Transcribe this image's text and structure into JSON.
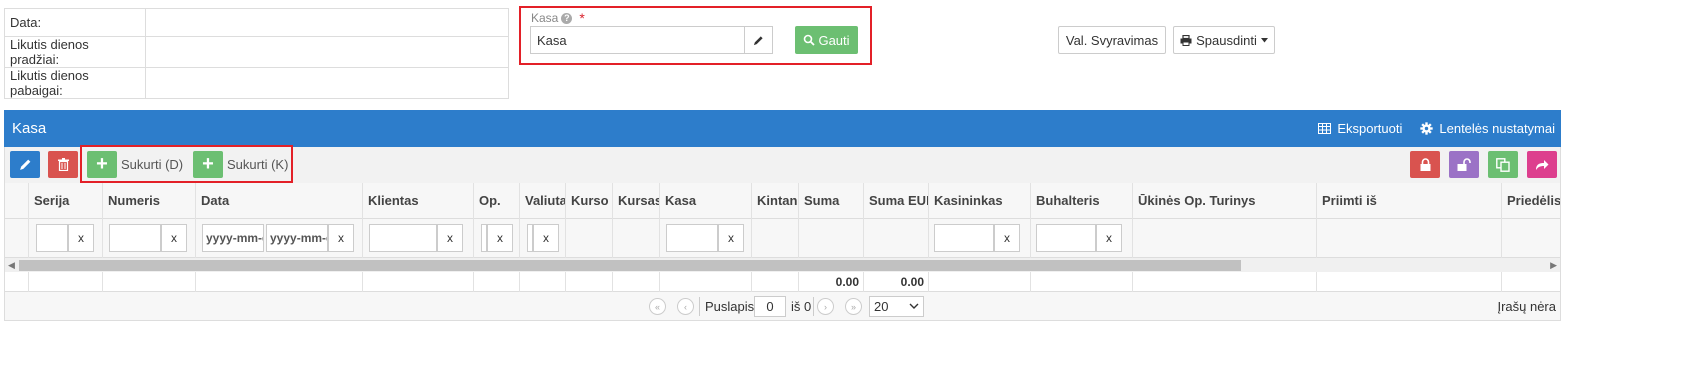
{
  "info": {
    "rows": [
      {
        "label": "Data:",
        "value": ""
      },
      {
        "label": "Likutis dienos pradžiai:",
        "value": ""
      },
      {
        "label": "Likutis dienos pabaigai:",
        "value": ""
      }
    ]
  },
  "kasa": {
    "label": "Kasa",
    "help": "?",
    "required": "*",
    "value": "Kasa",
    "get_button": "Gauti"
  },
  "actions": {
    "currency_button": "Val. Svyravimas",
    "print_button": "Spausdinti"
  },
  "panel": {
    "title": "Kasa",
    "export_label": "Eksportuoti",
    "settings_label": "Lentelės nustatymai"
  },
  "toolbar": {
    "create_debit": "Sukurti (D)",
    "create_credit": "Sukurti (K)",
    "plus": "+"
  },
  "table": {
    "columns": [
      "Serija",
      "Numeris",
      "Data",
      "Klientas",
      "Op.",
      "Valiuta",
      "Kurso d",
      "Kursas",
      "Kasa",
      "Kintan",
      "Suma",
      "Suma EUR",
      "Kasininkas",
      "Buhalteris",
      "Ūkinės Op. Turinys",
      "Priimti iš",
      "Priedėlis"
    ],
    "clear": "x",
    "date_placeholder": "yyyy-mm-dd",
    "totals": {
      "suma": "0.00",
      "suma_eur": "0.00"
    }
  },
  "pager": {
    "page_label": "Puslapis",
    "page_value": "0",
    "of_label": "iš 0",
    "page_size": "20",
    "status": "Įrašų nėra"
  },
  "colors": {
    "primary": "#2d7dcb",
    "success": "#6cbf72",
    "danger": "#d9534f",
    "highlight": "#e32028",
    "purple": "#9b72c6",
    "pink": "#dd3f8e"
  }
}
